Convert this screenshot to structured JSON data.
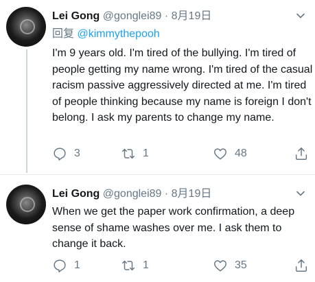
{
  "colors": {
    "text": "#14171a",
    "secondary": "#657786",
    "link": "#1da1f2",
    "thread_line": "#ccd6dd"
  },
  "tweets": [
    {
      "name": "Lei Gong",
      "handle": "@gonglei89",
      "separator": "·",
      "date": "8月19日",
      "reply_prefix": "回复",
      "reply_mention": "@kimmythepooh",
      "text": "I'm 9 years old. I'm tired of the bullying. I'm tired of people getting my name wrong. I'm tired of the casual racism passive aggressively directed at me. I'm tired of people thinking because my name is foreign I don't belong. I ask my parents to change my name.",
      "replies": "3",
      "retweets": "1",
      "likes": "48",
      "icons": [
        "reply-icon",
        "retweet-icon",
        "like-icon",
        "share-icon",
        "chevron-down-icon"
      ]
    },
    {
      "name": "Lei Gong",
      "handle": "@gonglei89",
      "separator": "·",
      "date": "8月19日",
      "text": "When we get the paper work confirmation, a deep sense of shame washes over me. I ask them to change it back.",
      "replies": "1",
      "retweets": "1",
      "likes": "35",
      "icons": [
        "reply-icon",
        "retweet-icon",
        "like-icon",
        "share-icon",
        "chevron-down-icon"
      ]
    }
  ]
}
